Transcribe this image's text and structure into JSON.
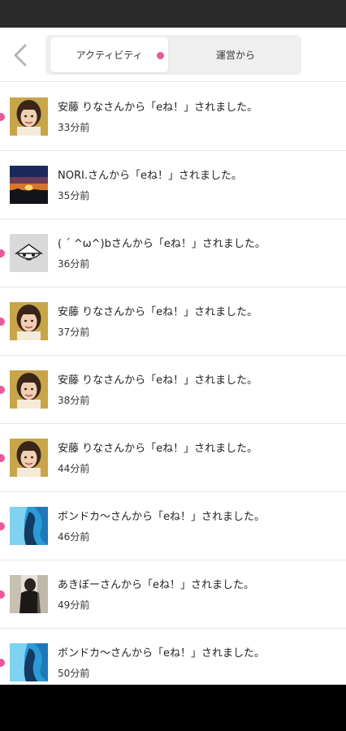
{
  "header": {
    "tabs": [
      {
        "label": "アクティビティ",
        "active": true,
        "has_badge": true
      },
      {
        "label": "運営から",
        "active": false
      }
    ]
  },
  "colors": {
    "accent": "#e85a9b",
    "status_bar": "#2b2b2b"
  },
  "notifications": [
    {
      "message": "安藤 りなさんから「eね！」されました。",
      "time": "33分前",
      "avatar": "portrait-woman-gold",
      "unread": true
    },
    {
      "message": "NORI.さんから「eね！」されました。",
      "time": "35分前",
      "avatar": "sunrise-landscape",
      "unread": false
    },
    {
      "message": "( ´ ^ω^)bさんから「eね！」されました。",
      "time": "36分前",
      "avatar": "default-character",
      "unread": true
    },
    {
      "message": "安藤 りなさんから「eね！」されました。",
      "time": "37分前",
      "avatar": "portrait-woman-gold",
      "unread": true
    },
    {
      "message": "安藤 りなさんから「eね！」されました。",
      "time": "38分前",
      "avatar": "portrait-woman-gold",
      "unread": true
    },
    {
      "message": "安藤 りなさんから「eね！」されました。",
      "time": "44分前",
      "avatar": "portrait-woman-gold",
      "unread": true
    },
    {
      "message": "ボンドカ～さんから「eね！」されました。",
      "time": "46分前",
      "avatar": "blue-abstract",
      "unread": true
    },
    {
      "message": "あきぼーさんから「eね！」されました。",
      "time": "49分前",
      "avatar": "dark-figure-photo",
      "unread": true
    },
    {
      "message": "ボンドカ～さんから「eね！」されました。",
      "time": "50分前",
      "avatar": "blue-abstract",
      "unread": true
    }
  ]
}
